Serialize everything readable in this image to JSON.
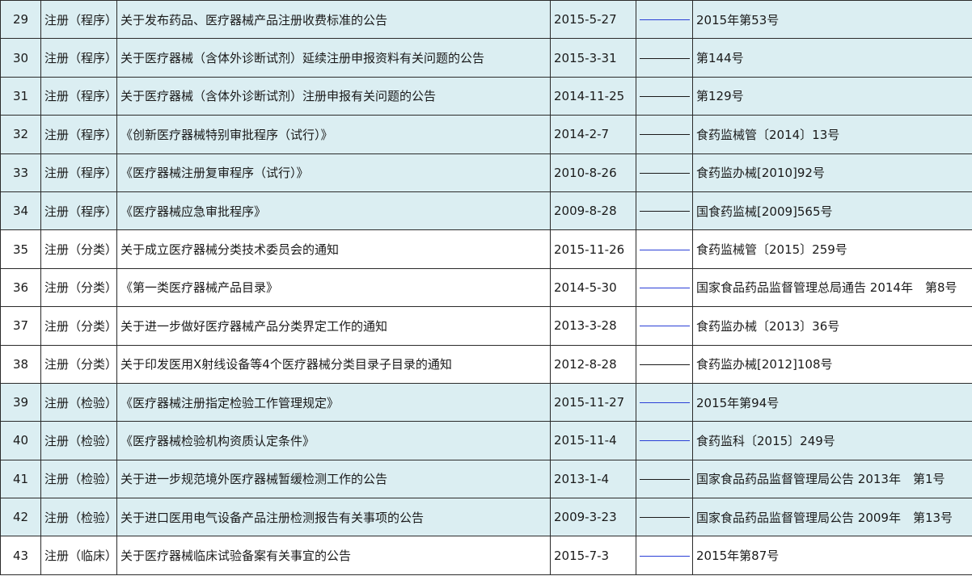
{
  "rows": [
    {
      "no": "29",
      "category": "注册（程序）",
      "title": "关于发布药品、医疗器械产品注册收费标准的公告",
      "date": "2015-5-27",
      "link": "blue",
      "doc": "2015年第53号",
      "shaded": true
    },
    {
      "no": "30",
      "category": "注册（程序）",
      "title": "关于医疗器械（含体外诊断试剂）延续注册申报资料有关问题的公告",
      "date": "2015-3-31",
      "link": "dark",
      "doc": "第144号",
      "shaded": true
    },
    {
      "no": "31",
      "category": "注册（程序）",
      "title": "关于医疗器械（含体外诊断试剂）注册申报有关问题的公告",
      "date": "2014-11-25",
      "link": "dark",
      "doc": "第129号",
      "shaded": true
    },
    {
      "no": "32",
      "category": "注册（程序）",
      "title": "《创新医疗器械特别审批程序（试行）》",
      "date": "2014-2-7",
      "link": "dark",
      "doc": "食药监械管〔2014〕13号",
      "shaded": true
    },
    {
      "no": "33",
      "category": "注册（程序）",
      "title": "《医疗器械注册复审程序（试行）》",
      "date": "2010-8-26",
      "link": "dark",
      "doc": "食药监办械[2010]92号",
      "shaded": true
    },
    {
      "no": "34",
      "category": "注册（程序）",
      "title": "《医疗器械应急审批程序》",
      "date": "2009-8-28",
      "link": "dark",
      "doc": "国食药监械[2009]565号",
      "shaded": true
    },
    {
      "no": "35",
      "category": "注册（分类）",
      "title": "关于成立医疗器械分类技术委员会的通知",
      "date": "2015-11-26",
      "link": "blue",
      "doc": "食药监械管〔2015〕259号",
      "shaded": false
    },
    {
      "no": "36",
      "category": "注册（分类）",
      "title": "《第一类医疗器械产品目录》",
      "date": "2014-5-30",
      "link": "blue",
      "doc": "国家食品药品监督管理总局通告 2014年　第8号",
      "shaded": false
    },
    {
      "no": "37",
      "category": "注册（分类）",
      "title": "关于进一步做好医疗器械产品分类界定工作的通知",
      "date": "2013-3-28",
      "link": "blue",
      "doc": "食药监办械〔2013〕36号",
      "shaded": false
    },
    {
      "no": "38",
      "category": "注册（分类）",
      "title": "关于印发医用X射线设备等4个医疗器械分类目录子目录的通知",
      "date": "2012-8-28",
      "link": "dark",
      "doc": "食药监办械[2012]108号",
      "shaded": false
    },
    {
      "no": "39",
      "category": "注册（检验）",
      "title": "《医疗器械注册指定检验工作管理规定》",
      "date": "2015-11-27",
      "link": "blue",
      "doc": "2015年第94号",
      "shaded": true
    },
    {
      "no": "40",
      "category": "注册（检验）",
      "title": "《医疗器械检验机构资质认定条件》",
      "date": "2015-11-4",
      "link": "blue",
      "doc": "食药监科〔2015〕249号",
      "shaded": true
    },
    {
      "no": "41",
      "category": "注册（检验）",
      "title": "关于进一步规范境外医疗器械暂缓检测工作的公告",
      "date": "2013-1-4",
      "link": "dark",
      "doc": "国家食品药品监督管理局公告 2013年　第1号",
      "shaded": true
    },
    {
      "no": "42",
      "category": "注册（检验）",
      "title": "关于进口医用电气设备产品注册检测报告有关事项的公告",
      "date": "2009-3-23",
      "link": "dark",
      "doc": "国家食品药品监督管理局公告 2009年　第13号",
      "shaded": true
    },
    {
      "no": "43",
      "category": "注册（临床）",
      "title": "关于医疗器械临床试验备案有关事宜的公告",
      "date": "2015-7-3",
      "link": "blue",
      "doc": "2015年第87号",
      "shaded": false
    }
  ],
  "colors": {
    "shaded_row": "#dbeef2",
    "plain_row": "#ffffff",
    "grid": "#2b2b2b",
    "link_blue": "#2a3fd6",
    "link_dark": "#1a1a1a"
  }
}
